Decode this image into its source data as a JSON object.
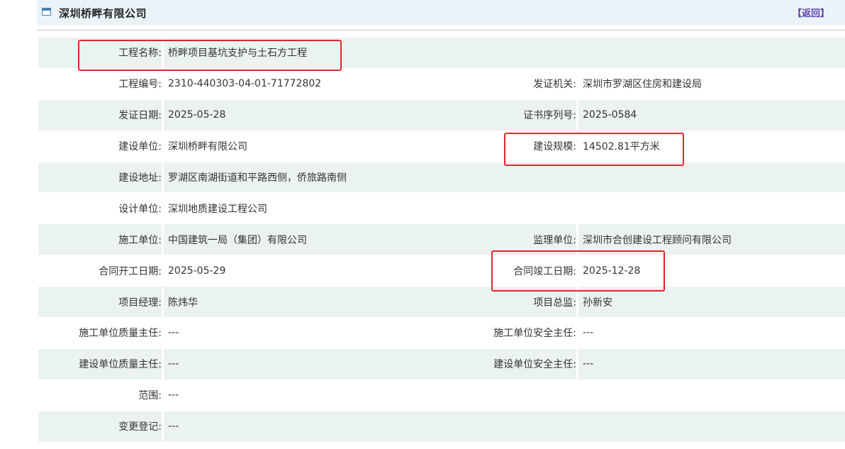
{
  "header": {
    "company_name": "深圳桥畔有限公司",
    "back_label": "【返回】"
  },
  "rows": [
    {
      "label1": "工程名称:",
      "value1": "桥畔项目基坑支护与土石方工程",
      "wide": true
    },
    {
      "label1": "工程编号:",
      "value1": "2310-440303-04-01-71772802",
      "label2": "发证机关:",
      "value2": "深圳市罗湖区住房和建设局"
    },
    {
      "label1": "发证日期:",
      "value1": "2025-05-28",
      "label2": "证书序列号:",
      "value2": "2025-0584"
    },
    {
      "label1": "建设单位:",
      "value1": "深圳桥畔有限公司",
      "label2": "建设规模:",
      "value2": "14502.81平方米"
    },
    {
      "label1": "建设地址:",
      "value1": "罗湖区南湖街道和平路西侧，侨旅路南侧",
      "wide": true
    },
    {
      "label1": "设计单位:",
      "value1": "深圳地质建设工程公司",
      "wide": true
    },
    {
      "label1": "施工单位:",
      "value1": "中国建筑一局（集团）有限公司",
      "label2": "监理单位:",
      "value2": "深圳市合创建设工程顾问有限公司"
    },
    {
      "label1": "合同开工日期:",
      "value1": "2025-05-29",
      "label2": "合同竣工日期:",
      "value2": "2025-12-28"
    },
    {
      "label1": "项目经理:",
      "value1": "陈炜华",
      "label2": "项目总监:",
      "value2": "孙新安"
    },
    {
      "label1": "施工单位质量主任:",
      "value1": "---",
      "label2": "施工单位安全主任:",
      "value2": "---"
    },
    {
      "label1": "建设单位质量主任:",
      "value1": "---",
      "label2": "建设单位安全主任:",
      "value2": "---"
    },
    {
      "label1": "范围:",
      "value1": "---",
      "wide": true
    },
    {
      "label1": "变更登记:",
      "value1": "---",
      "wide": true
    }
  ],
  "annotation_color": "#e0262b",
  "icons": {
    "title_icon": "window-icon"
  }
}
